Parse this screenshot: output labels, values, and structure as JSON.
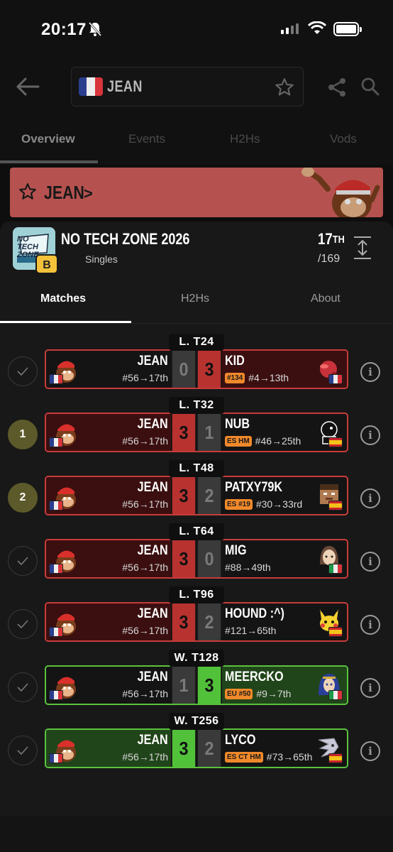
{
  "status": {
    "time": "20:17"
  },
  "header": {
    "search_value": "JEAN"
  },
  "tabs": [
    {
      "label": "Overview"
    },
    {
      "label": "Events"
    },
    {
      "label": "H2Hs"
    },
    {
      "label": "Vods"
    }
  ],
  "banner": {
    "player": "JEAN",
    "chevron": ">"
  },
  "tournament": {
    "name": "NO TECH ZONE 2026",
    "logo_text": "NO TECH ZONE",
    "tier": "B",
    "type": "Singles",
    "placing": "17",
    "placing_suffix": "TH",
    "entrants": "/169"
  },
  "subtabs": [
    {
      "label": "Matches"
    },
    {
      "label": "H2Hs"
    },
    {
      "label": "About"
    }
  ],
  "matches": [
    {
      "round": "L. T24",
      "left_marker": "check",
      "result": "loss",
      "p1": {
        "name": "JEAN",
        "seed": "#56→17th",
        "score": "0"
      },
      "p2": {
        "name": "KID",
        "tag": "#134",
        "seed": "#4→13th",
        "score": "3",
        "flag": "fr",
        "char": "kirby"
      }
    },
    {
      "round": "L. T32",
      "left_marker": "1",
      "result": "loss",
      "p1": {
        "name": "JEAN",
        "seed": "#56→17th",
        "score": "3"
      },
      "p2": {
        "name": "NUB",
        "tag": "ES HM",
        "seed": "#46→25th",
        "score": "1",
        "flag": "es",
        "char": "gameandwatch"
      }
    },
    {
      "round": "L. T48",
      "left_marker": "2",
      "result": "loss",
      "p1": {
        "name": "JEAN",
        "seed": "#56→17th",
        "score": "3"
      },
      "p2": {
        "name": "PATXY79K",
        "tag": "ES #19",
        "seed": "#30→33rd",
        "score": "2",
        "flag": "es",
        "char": "steve"
      }
    },
    {
      "round": "L. T64",
      "left_marker": "check",
      "result": "loss",
      "p1": {
        "name": "JEAN",
        "seed": "#56→17th",
        "score": "3"
      },
      "p2": {
        "name": "MIG",
        "tag": "",
        "seed": "#88→49th",
        "score": "0",
        "flag": "it",
        "char": "mii"
      }
    },
    {
      "round": "L. T96",
      "left_marker": "check",
      "result": "loss",
      "p1": {
        "name": "JEAN",
        "seed": "#56→17th",
        "score": "3"
      },
      "p2": {
        "name": "HOUND :^)",
        "tag": "",
        "seed": "#121→65th",
        "score": "2",
        "flag": "es",
        "char": "pikachu"
      }
    },
    {
      "round": "W. T128",
      "left_marker": "check",
      "result": "win",
      "p1": {
        "name": "JEAN",
        "seed": "#56→17th",
        "score": "1"
      },
      "p2": {
        "name": "MEERCKO",
        "tag": "EU #50",
        "seed": "#9→7th",
        "score": "3",
        "flag": "it",
        "char": "lucina"
      }
    },
    {
      "round": "W. T256",
      "left_marker": "check",
      "result": "win",
      "p1": {
        "name": "JEAN",
        "seed": "#56→17th",
        "score": "3"
      },
      "p2": {
        "name": "LYCO",
        "tag": "ES CT HM",
        "seed": "#73→65th",
        "score": "2",
        "flag": "es",
        "char": "sonic"
      }
    }
  ],
  "colors": {
    "loss": "#c83c3a",
    "win": "#5bc23e",
    "gold_marker": "#5c5a2a",
    "tag": "#f0892a"
  }
}
